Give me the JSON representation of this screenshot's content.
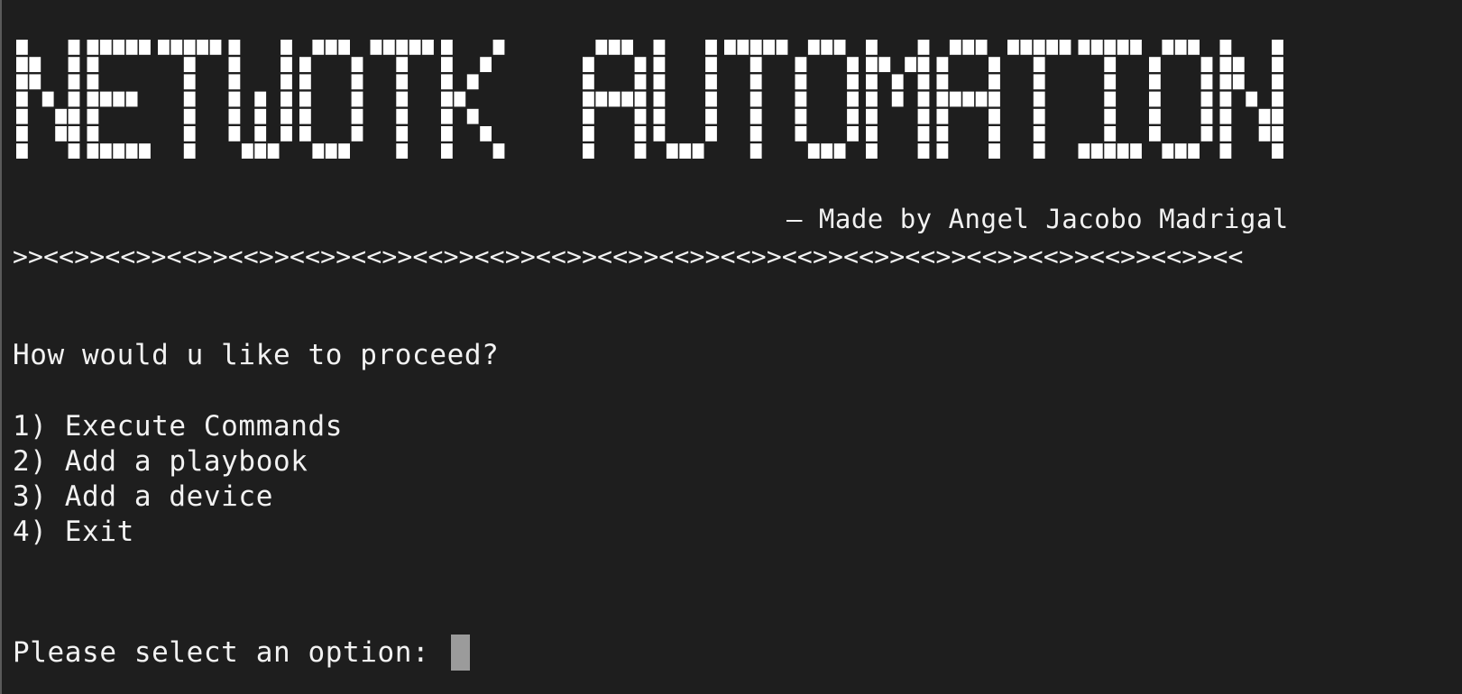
{
  "banner": {
    "text": "NETWOTK AUTOMATION",
    "color": "#ffffff"
  },
  "credit": "— Made by Angel Jacobo Madrigal",
  "separator": ">><<>><<>><<>><<>><<>><<>><<>><<>><<>><<>><<>><<>><<>><<>><<>><<>><<>><<>><<>><<",
  "menu": {
    "question": "How would u like to proceed?",
    "options": [
      "1) Execute Commands",
      "2) Add a playbook",
      "3) Add a device",
      "4) Exit"
    ]
  },
  "prompt": {
    "label": "Please select an option: ",
    "input_value": ""
  },
  "colors": {
    "background": "#1e1e1e",
    "text": "#f2f2f2",
    "cursor": "#9b9b9b"
  }
}
